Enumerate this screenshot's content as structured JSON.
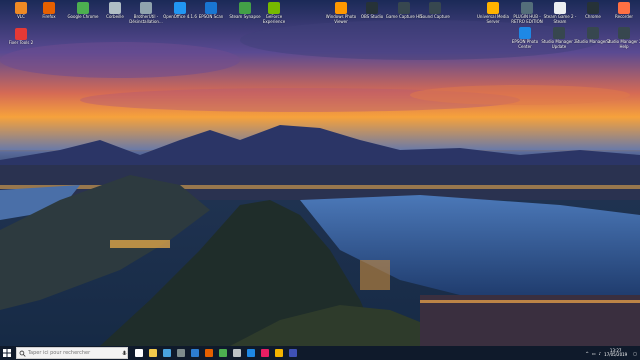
{
  "desktop": {
    "icons": [
      {
        "label": "VLC",
        "color": "#f08a24"
      },
      {
        "label": "Firefox",
        "color": "#e66000"
      },
      {
        "label": "Google Chrome",
        "color": "#4caf50"
      },
      {
        "label": "Corbeille",
        "color": "#b0bec5"
      },
      {
        "label": "BrotherUtil - Désinstallation...",
        "color": "#90a4ae"
      },
      {
        "label": "OpenOffice 4.1.6",
        "color": "#2196f3"
      },
      {
        "label": "EPSON Scan",
        "color": "#1976d2"
      },
      {
        "label": "Steam Synapse",
        "color": "#43a047"
      },
      {
        "label": "GeForce Experience",
        "color": "#76b900"
      },
      {
        "label": "Windows Photo Viewer",
        "color": "#ff9800"
      },
      {
        "label": "OBS Studio",
        "color": "#263238"
      },
      {
        "label": "Game Capture HD",
        "color": "#37474f"
      },
      {
        "label": "Sound Capture",
        "color": "#37474f"
      },
      {
        "label": "Universal Media Server",
        "color": "#ffb300"
      },
      {
        "label": "PLUGIN HUB - RETRO EDITION",
        "color": "#546e7a"
      },
      {
        "label": "Steam Game 2 - Steam",
        "color": "#eceff1"
      },
      {
        "label": "Chrome",
        "color": "#263238"
      },
      {
        "label": "Recorder",
        "color": "#ff7043"
      },
      {
        "label": "EPSON Photo Center",
        "color": "#1e88e5"
      },
      {
        "label": "Studio Manager 2 Update",
        "color": "#37474f"
      },
      {
        "label": "Studio Manager 2",
        "color": "#37474f"
      },
      {
        "label": "Studio Manager 2 Help",
        "color": "#37474f"
      },
      {
        "label": "Fixer Tools 2",
        "color": "#e53935"
      }
    ]
  },
  "taskbar": {
    "search_placeholder": "Taper ici pour rechercher",
    "apps": [
      {
        "name": "task-view-icon",
        "color": "#ffffff"
      },
      {
        "name": "explorer-icon",
        "color": "#f2c94c"
      },
      {
        "name": "mail-icon",
        "color": "#4aa3df"
      },
      {
        "name": "calculator-icon",
        "color": "#7f8c8d"
      },
      {
        "name": "edge-icon",
        "color": "#2d7dd2"
      },
      {
        "name": "firefox-icon",
        "color": "#e66000"
      },
      {
        "name": "chrome-icon",
        "color": "#4caf50"
      },
      {
        "name": "clock-app-icon",
        "color": "#bdc3c7"
      },
      {
        "name": "photos-icon",
        "color": "#1e88e5"
      },
      {
        "name": "music-icon",
        "color": "#e91e63"
      },
      {
        "name": "folder-icon",
        "color": "#f4b400"
      },
      {
        "name": "store-icon",
        "color": "#3f51b5"
      }
    ],
    "clock_time": "13:27",
    "clock_date": "17/05/2019"
  }
}
